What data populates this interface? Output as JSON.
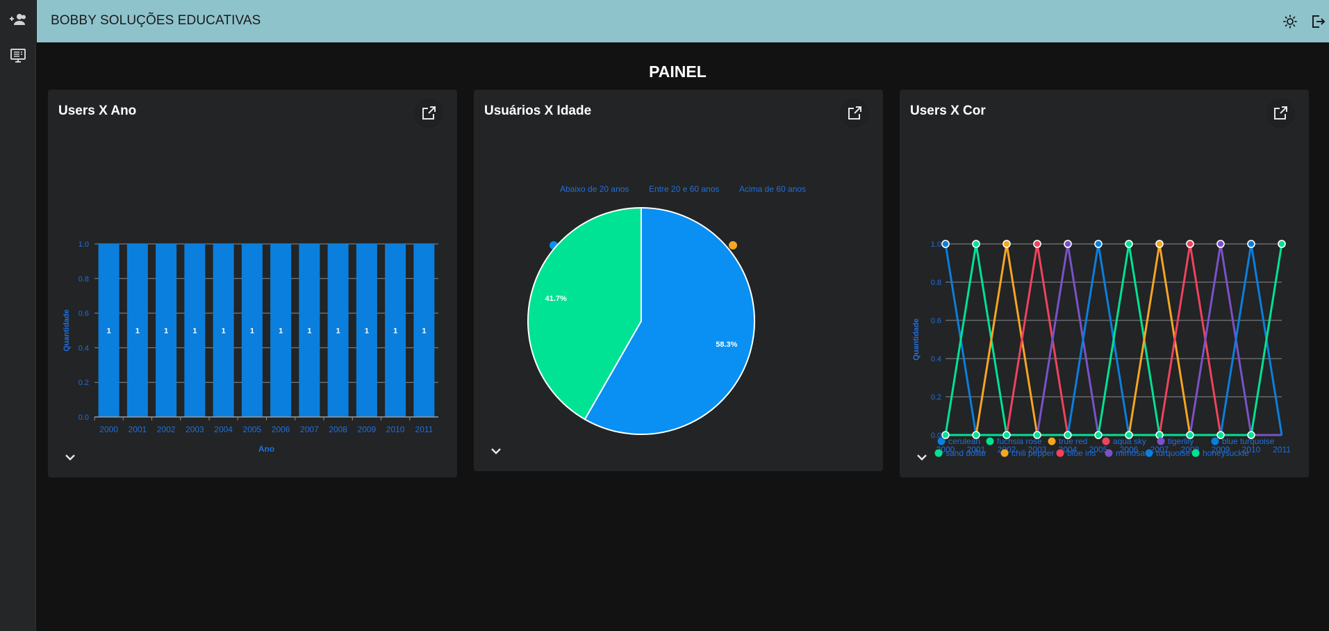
{
  "app": {
    "title": "BOBBY SOLUÇÕES EDUCATIVAS"
  },
  "page": {
    "title": "PAINEL"
  },
  "rail": {
    "icons": [
      "group-add-icon",
      "monitor-icon"
    ]
  },
  "toolbar": {
    "icons": [
      "brightness-icon",
      "logout-icon"
    ]
  },
  "cards": {
    "users_year": {
      "title": "Users X Ano"
    },
    "users_age": {
      "title": "Usuários X Idade"
    },
    "users_color": {
      "title": "Users X Cor"
    }
  },
  "colors": {
    "blue": "#0b7fdd",
    "pie_blue": "#0a8ff3",
    "green": "#00e394",
    "orange": "#f5a623",
    "red": "#f0435e",
    "purple": "#7a52c8",
    "text": "#1f6fe0",
    "appbar": "#8fc3cc"
  },
  "chart_data": [
    {
      "type": "bar",
      "title": "Users X Ano",
      "xlabel": "Ano",
      "ylabel": "Quantidade",
      "categories": [
        "2000",
        "2001",
        "2002",
        "2003",
        "2004",
        "2005",
        "2006",
        "2007",
        "2008",
        "2009",
        "2010",
        "2011"
      ],
      "values": [
        1,
        1,
        1,
        1,
        1,
        1,
        1,
        1,
        1,
        1,
        1,
        1
      ],
      "ylim": [
        0,
        1
      ],
      "yticks": [
        "0.0",
        "0.2",
        "0.4",
        "0.6",
        "0.8",
        "1.0"
      ],
      "data_labels": [
        "1",
        "1",
        "1",
        "1",
        "1",
        "1",
        "1",
        "1",
        "1",
        "1",
        "1",
        "1"
      ],
      "grid": true
    },
    {
      "type": "pie",
      "title": "Usuários X Idade",
      "legend": [
        "Abaixo de 20 anos",
        "Entre 20 e 60 anos",
        "Acima de 60 anos"
      ],
      "values": [
        58.3,
        41.7,
        0
      ],
      "labels": [
        "58.3%",
        "41.7%",
        ""
      ],
      "legend_position": "top"
    },
    {
      "type": "line",
      "title": "Users X Cor",
      "xlabel": "Ano",
      "ylabel": "Quantidade",
      "x": [
        "2000",
        "2001",
        "2002",
        "2003",
        "2004",
        "2005",
        "2006",
        "2007",
        "2008",
        "2009",
        "2010",
        "2011"
      ],
      "ylim": [
        0,
        1
      ],
      "yticks": [
        "0.0",
        "0.2",
        "0.4",
        "0.6",
        "0.8",
        "1.0"
      ],
      "grid": true,
      "legend_position": "bottom",
      "series": [
        {
          "name": "cerulean",
          "peak": 0,
          "color": "#0b7fdd"
        },
        {
          "name": "fuchsia rose",
          "peak": 1,
          "color": "#00e394"
        },
        {
          "name": "true red",
          "peak": 2,
          "color": "#f5a623"
        },
        {
          "name": "aqua sky",
          "peak": 3,
          "color": "#f0435e"
        },
        {
          "name": "tigerlily",
          "peak": 4,
          "color": "#7a52c8"
        },
        {
          "name": "blue turquoise",
          "peak": 5,
          "color": "#0b7fdd"
        },
        {
          "name": "sand dollar",
          "peak": 6,
          "color": "#00e394"
        },
        {
          "name": "chili pepper",
          "peak": 7,
          "color": "#f5a623"
        },
        {
          "name": "blue iris",
          "peak": 8,
          "color": "#f0435e"
        },
        {
          "name": "mimosa",
          "peak": 9,
          "color": "#7a52c8"
        },
        {
          "name": "turquoise",
          "peak": 10,
          "color": "#0b7fdd"
        },
        {
          "name": "honeysuckle",
          "peak": 11,
          "color": "#00e394"
        }
      ]
    }
  ]
}
